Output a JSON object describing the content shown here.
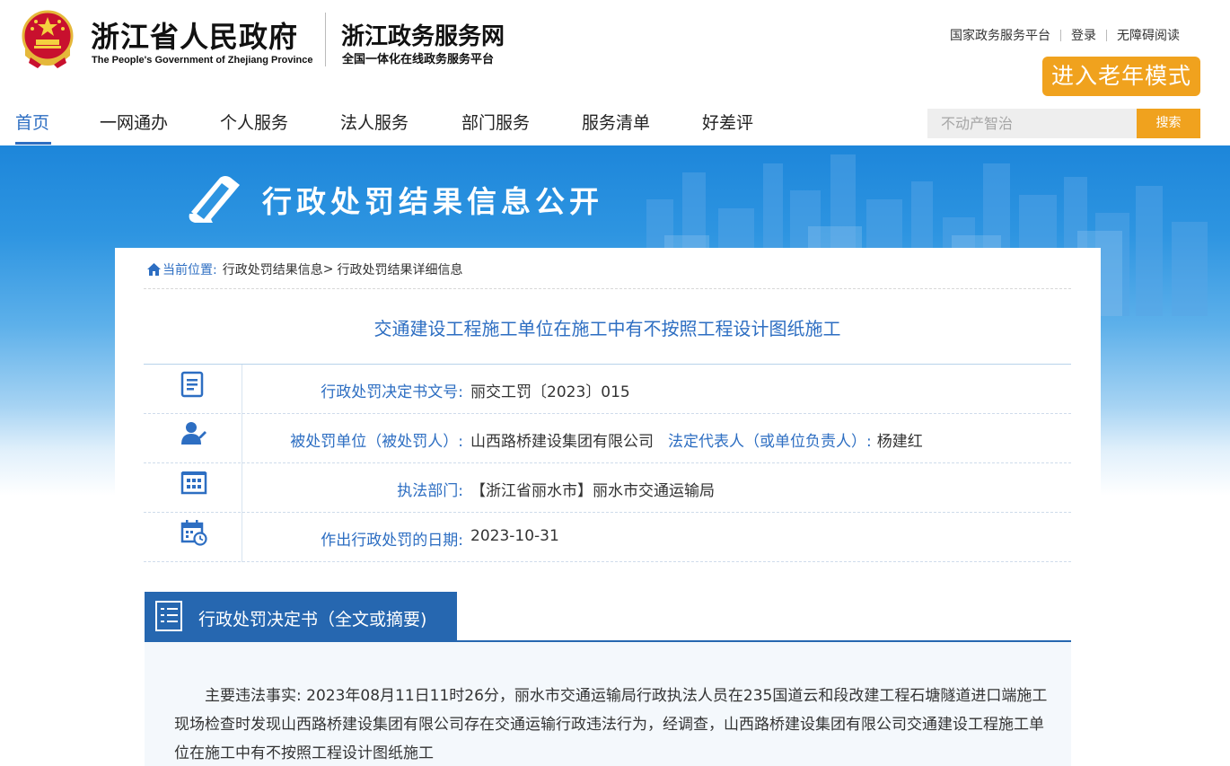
{
  "header": {
    "logo_cn": "浙江省人民政府",
    "logo_en": "The People's Government of Zhejiang Province",
    "site_name": "浙江政务服务网",
    "site_sub": "全国一体化在线政务服务平台",
    "links": [
      "国家政务服务平台",
      "登录",
      "无障碍阅读"
    ],
    "elder_mode": "进入老年模式"
  },
  "nav": {
    "items": [
      "首页",
      "一网通办",
      "个人服务",
      "法人服务",
      "部门服务",
      "服务清单",
      "好差评"
    ],
    "active": "首页"
  },
  "search": {
    "placeholder": "不动产智治",
    "button": "搜索"
  },
  "banner": {
    "title": "行政处罚结果信息公开"
  },
  "breadcrumb": {
    "current_label": "当前位置:",
    "items": [
      "行政处罚结果信息",
      "行政处罚结果详细信息"
    ],
    "separator": ">"
  },
  "page_title": "交通建设工程施工单位在施工中有不按照工程设计图纸施工",
  "info": {
    "doc_no": {
      "label": "行政处罚决定书文号:",
      "value": "丽交工罚〔2023〕015",
      "icon": "document-icon"
    },
    "party": {
      "label": "被处罚单位（被处罚人）:",
      "value": "山西路桥建设集团有限公司",
      "label2": "法定代表人（或单位负责人）:",
      "value2": "杨建红",
      "icon": "person-icon"
    },
    "dept": {
      "label": "执法部门:",
      "value": "【浙江省丽水市】丽水市交通运输局",
      "icon": "building-icon"
    },
    "date": {
      "label": "作出行政处罚的日期:",
      "value": "2023-10-31",
      "icon": "calendar-icon"
    }
  },
  "decision": {
    "title": "行政处罚决定书（全文或摘要)",
    "text": "主要违法事实: 2023年08月11日11时26分，丽水市交通运输局行政执法人员在235国道云和段改建工程石塘隧道进口端施工现场检查时发现山西路桥建设集团有限公司存在交通运输行政违法行为，经调查，山西路桥建设集团有限公司交通建设工程施工单位在施工中有不按照工程设计图纸施工"
  },
  "colors": {
    "accent": "#2d6ec2",
    "orange": "#f0a21e",
    "section": "#2667b0"
  }
}
